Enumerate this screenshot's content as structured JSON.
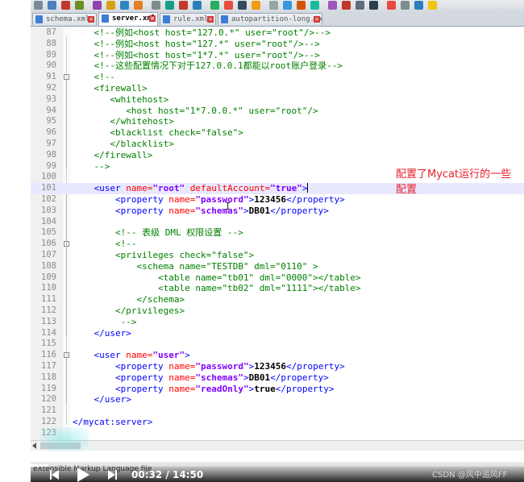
{
  "tabs": [
    {
      "label": "schema.xml",
      "active": false
    },
    {
      "label": "server.xml",
      "active": true
    },
    {
      "label": "rule.xml",
      "active": false
    },
    {
      "label": "autopartition-long.txt",
      "active": false
    }
  ],
  "lines": [
    {
      "n": "87",
      "t": [
        [
          "    ",
          ""
        ],
        [
          "<!--例如<host host=\"127.0.*\" user=\"root\"/>-->",
          "c-comment"
        ]
      ]
    },
    {
      "n": "88",
      "t": [
        [
          "    ",
          ""
        ],
        [
          "<!--例如<host host=\"127.*\" user=\"root\"/>-->",
          "c-comment"
        ]
      ]
    },
    {
      "n": "89",
      "t": [
        [
          "    ",
          ""
        ],
        [
          "<!--例如<host host=\"1*7.*\" user=\"root\"/>-->",
          "c-comment"
        ]
      ]
    },
    {
      "n": "90",
      "t": [
        [
          "    ",
          ""
        ],
        [
          "<!--这些配置情况下对于127.0.0.1都能以root账户登录-->",
          "c-comment"
        ]
      ]
    },
    {
      "n": "91",
      "t": [
        [
          "    ",
          ""
        ],
        [
          "<!--",
          "c-comment"
        ]
      ]
    },
    {
      "n": "92",
      "t": [
        [
          "    ",
          ""
        ],
        [
          "<firewall>",
          "c-comment"
        ]
      ]
    },
    {
      "n": "93",
      "t": [
        [
          "       ",
          ""
        ],
        [
          "<whitehost>",
          "c-comment"
        ]
      ]
    },
    {
      "n": "94",
      "t": [
        [
          "          ",
          ""
        ],
        [
          "<host host=\"1*7.0.0.*\" user=\"root\"/>",
          "c-comment"
        ]
      ]
    },
    {
      "n": "95",
      "t": [
        [
          "       ",
          ""
        ],
        [
          "</whitehost>",
          "c-comment"
        ]
      ]
    },
    {
      "n": "96",
      "t": [
        [
          "       ",
          ""
        ],
        [
          "<blacklist check=\"false\">",
          "c-comment"
        ]
      ]
    },
    {
      "n": "97",
      "t": [
        [
          "       ",
          ""
        ],
        [
          "</blacklist>",
          "c-comment"
        ]
      ]
    },
    {
      "n": "98",
      "t": [
        [
          "    ",
          ""
        ],
        [
          "</firewall>",
          "c-comment"
        ]
      ]
    },
    {
      "n": "99",
      "t": [
        [
          "    ",
          ""
        ],
        [
          "-->",
          "c-comment"
        ]
      ]
    },
    {
      "n": "100",
      "t": []
    },
    {
      "n": "101",
      "t": [
        [
          "    ",
          ""
        ],
        [
          "<user ",
          "c-tag"
        ],
        [
          "name=",
          "c-attr"
        ],
        [
          "\"root\"",
          "c-str"
        ],
        [
          " defaultAccount=",
          "c-attr"
        ],
        [
          "\"true\"",
          "c-str"
        ],
        [
          ">",
          "c-tag"
        ]
      ],
      "current": true
    },
    {
      "n": "102",
      "t": [
        [
          "        ",
          ""
        ],
        [
          "<property ",
          "c-tag"
        ],
        [
          "name=",
          "c-attr"
        ],
        [
          "\"password\"",
          "c-str"
        ],
        [
          ">",
          "c-tag"
        ],
        [
          "123456",
          "c-text"
        ],
        [
          "</property>",
          "c-tag"
        ]
      ]
    },
    {
      "n": "103",
      "t": [
        [
          "        ",
          ""
        ],
        [
          "<property ",
          "c-tag"
        ],
        [
          "name=",
          "c-attr"
        ],
        [
          "\"schemas\"",
          "c-str"
        ],
        [
          ">",
          "c-tag"
        ],
        [
          "DB01",
          "c-text"
        ],
        [
          "</property>",
          "c-tag"
        ]
      ]
    },
    {
      "n": "104",
      "t": []
    },
    {
      "n": "105",
      "t": [
        [
          "        ",
          ""
        ],
        [
          "<!-- 表级 DML 权限设置 -->",
          "c-comment"
        ]
      ]
    },
    {
      "n": "106",
      "t": [
        [
          "        ",
          ""
        ],
        [
          "<!--",
          "c-comment"
        ]
      ]
    },
    {
      "n": "107",
      "t": [
        [
          "        ",
          ""
        ],
        [
          "<privileges check=\"false\">",
          "c-comment"
        ]
      ]
    },
    {
      "n": "108",
      "t": [
        [
          "            ",
          ""
        ],
        [
          "<schema name=\"TESTDB\" dml=\"0110\" >",
          "c-comment"
        ]
      ]
    },
    {
      "n": "109",
      "t": [
        [
          "                ",
          ""
        ],
        [
          "<table name=\"tb01\" dml=\"0000\"></table>",
          "c-comment"
        ]
      ]
    },
    {
      "n": "110",
      "t": [
        [
          "                ",
          ""
        ],
        [
          "<table name=\"tb02\" dml=\"1111\"></table>",
          "c-comment"
        ]
      ]
    },
    {
      "n": "111",
      "t": [
        [
          "            ",
          ""
        ],
        [
          "</schema>",
          "c-comment"
        ]
      ]
    },
    {
      "n": "112",
      "t": [
        [
          "        ",
          ""
        ],
        [
          "</privileges>",
          "c-comment"
        ]
      ]
    },
    {
      "n": "113",
      "t": [
        [
          "         ",
          ""
        ],
        [
          "-->",
          "c-comment"
        ]
      ]
    },
    {
      "n": "114",
      "t": [
        [
          "    ",
          ""
        ],
        [
          "</user>",
          "c-tag"
        ]
      ]
    },
    {
      "n": "115",
      "t": []
    },
    {
      "n": "116",
      "t": [
        [
          "    ",
          ""
        ],
        [
          "<user ",
          "c-tag"
        ],
        [
          "name=",
          "c-attr"
        ],
        [
          "\"user\"",
          "c-str"
        ],
        [
          ">",
          "c-tag"
        ]
      ]
    },
    {
      "n": "117",
      "t": [
        [
          "        ",
          ""
        ],
        [
          "<property ",
          "c-tag"
        ],
        [
          "name=",
          "c-attr"
        ],
        [
          "\"password\"",
          "c-str"
        ],
        [
          ">",
          "c-tag"
        ],
        [
          "123456",
          "c-text"
        ],
        [
          "</property>",
          "c-tag"
        ]
      ]
    },
    {
      "n": "118",
      "t": [
        [
          "        ",
          ""
        ],
        [
          "<property ",
          "c-tag"
        ],
        [
          "name=",
          "c-attr"
        ],
        [
          "\"schemas\"",
          "c-str"
        ],
        [
          ">",
          "c-tag"
        ],
        [
          "DB01",
          "c-text"
        ],
        [
          "</property>",
          "c-tag"
        ]
      ]
    },
    {
      "n": "119",
      "t": [
        [
          "        ",
          ""
        ],
        [
          "<property ",
          "c-tag"
        ],
        [
          "name=",
          "c-attr"
        ],
        [
          "\"readOnly\"",
          "c-str"
        ],
        [
          ">",
          "c-tag"
        ],
        [
          "true",
          "c-text"
        ],
        [
          "</property>",
          "c-tag"
        ]
      ]
    },
    {
      "n": "120",
      "t": [
        [
          "    ",
          ""
        ],
        [
          "</user>",
          "c-tag"
        ]
      ]
    },
    {
      "n": "121",
      "t": []
    },
    {
      "n": "122",
      "t": [
        [
          "",
          ""
        ],
        [
          "</mycat:server>",
          "c-tag"
        ]
      ]
    },
    {
      "n": "123",
      "t": []
    }
  ],
  "annotation": "配置了Mycat运行的一些配置",
  "status": {
    "file_type": "eXtensible Markup Language file"
  },
  "video": {
    "current_time": "00:32",
    "separator": "/",
    "duration": "14:50",
    "progress_pct": 3.6
  },
  "watermark": "CSDN @风中追风FF",
  "colors": {
    "comment": "#008000",
    "tag": "#0000ff",
    "attr": "#ff0000",
    "string": "#8000ff",
    "annotation": "#e8202a",
    "current_line": "#e8e8ff"
  }
}
